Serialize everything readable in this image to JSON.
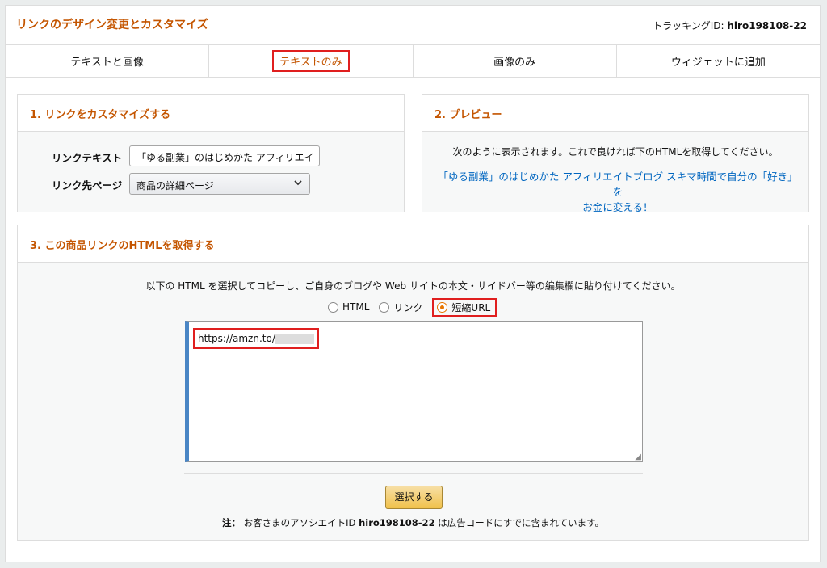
{
  "header": {
    "title": "リンクのデザイン変更とカスタマイズ",
    "tracking_label": "トラッキングID: ",
    "tracking_id": "hiro198108-22"
  },
  "tabs": [
    {
      "label": "テキストと画像",
      "active": false
    },
    {
      "label": "テキストのみ",
      "active": true
    },
    {
      "label": "画像のみ",
      "active": false
    },
    {
      "label": "ウィジェットに追加",
      "active": false
    }
  ],
  "customize": {
    "heading": "1. リンクをカスタマイズする",
    "link_text_label": "リンクテキスト",
    "link_text_value": "「ゆる副業」のはじめかた アフィリエイ",
    "link_dest_label": "リンク先ページ",
    "link_dest_value": "商品の詳細ページ"
  },
  "preview": {
    "heading": "2. プレビュー",
    "description": "次のように表示されます。これで良ければ下のHTMLを取得してください。",
    "link_line1": "「ゆる副業」のはじめかた アフィリエイトブログ スキマ時間で自分の「好き」を",
    "link_line2": "お金に変える！"
  },
  "get_html": {
    "heading": "3. この商品リンクのHTMLを取得する",
    "instructions": "以下の HTML を選択してコピーし、ご自身のブログや Web サイトの本文・サイドバー等の編集欄に貼り付けてください。",
    "radio_options": [
      {
        "label": "HTML",
        "selected": false
      },
      {
        "label": "リンク",
        "selected": false
      },
      {
        "label": "短縮URL",
        "selected": true
      }
    ],
    "code_value": "https://amzn.to/",
    "select_button": "選択する",
    "note_prefix": "注：",
    "note_text1": " お客さまのアソシエイトID ",
    "note_id": "hiro198108-22",
    "note_text2": " は広告コードにすでに含まれています。"
  },
  "colors": {
    "accent": "#c45500",
    "link": "#0066c0",
    "highlight": "#e01f1f",
    "button": "#f0c14b"
  }
}
